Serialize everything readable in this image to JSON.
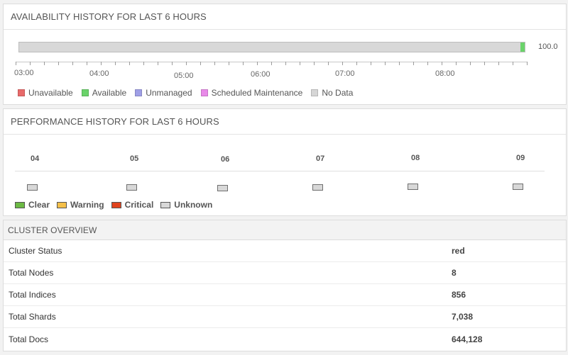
{
  "availability": {
    "title": "AVAILABILITY HISTORY FOR LAST 6 HOURS",
    "available_percent": 100.0,
    "value_label": "100.0",
    "time_labels": [
      "03:00",
      "04:00",
      "05:00",
      "06:00",
      "07:00",
      "08:00"
    ],
    "legend": [
      {
        "label": "Unavailable",
        "color": "#e86a6a"
      },
      {
        "label": "Available",
        "color": "#6ad36a"
      },
      {
        "label": "Unmanaged",
        "color": "#9f9fe6"
      },
      {
        "label": "Scheduled Maintenance",
        "color": "#e88ae8"
      },
      {
        "label": "No Data",
        "color": "#d6d6d6"
      }
    ]
  },
  "performance": {
    "title": "PERFORMANCE HISTORY FOR LAST 6 HOURS",
    "hours": [
      "04",
      "05",
      "06",
      "07",
      "08",
      "09"
    ],
    "status": [
      "Unknown",
      "Unknown",
      "Unknown",
      "Unknown",
      "Unknown",
      "Unknown"
    ],
    "legend": [
      {
        "label": "Clear",
        "color": "#6cba44"
      },
      {
        "label": "Warning",
        "color": "#f5c04a"
      },
      {
        "label": "Critical",
        "color": "#e0431e"
      },
      {
        "label": "Unknown",
        "color": "#d8d8d8"
      }
    ]
  },
  "cluster": {
    "title": "CLUSTER OVERVIEW",
    "rows": [
      {
        "label": "Cluster Status",
        "value": "red"
      },
      {
        "label": "Total Nodes",
        "value": "8"
      },
      {
        "label": "Total Indices",
        "value": "856"
      },
      {
        "label": "Total Shards",
        "value": "7,038"
      },
      {
        "label": "Total Docs",
        "value": "644,128"
      }
    ]
  }
}
